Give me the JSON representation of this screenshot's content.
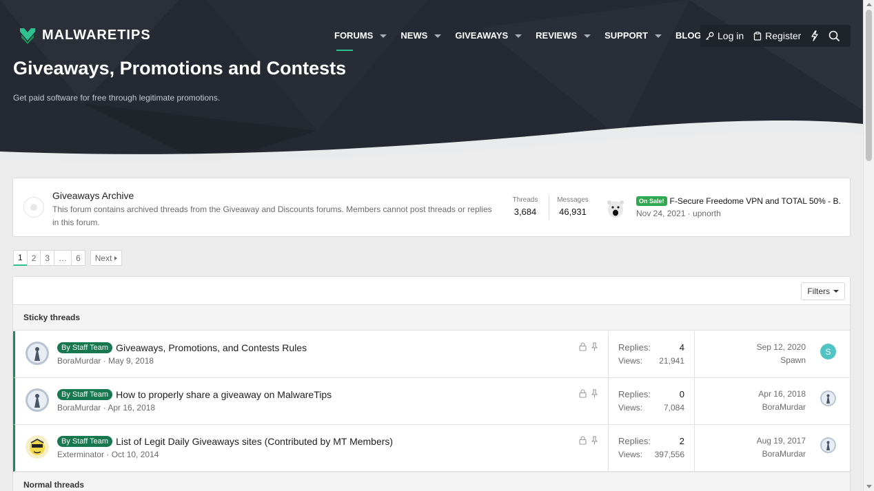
{
  "brand": {
    "name": "MALWARETIPS",
    "accent": "#2ec08e"
  },
  "nav": {
    "items": [
      {
        "label": "FORUMS",
        "active": true,
        "dropdown": true
      },
      {
        "label": "NEWS",
        "dropdown": true
      },
      {
        "label": "GIVEAWAYS",
        "dropdown": true
      },
      {
        "label": "REVIEWS",
        "dropdown": true
      },
      {
        "label": "SUPPORT",
        "dropdown": true
      },
      {
        "label": "BLOG",
        "dropdown": false
      }
    ],
    "login": "Log in",
    "register": "Register"
  },
  "page": {
    "title": "Giveaways, Promotions and Contests",
    "description": "Get paid software for free through legitimate promotions."
  },
  "archive": {
    "title": "Giveaways Archive",
    "description": "This forum contains archived threads from the Giveaway and Discounts forums. Members cannot post threads or replies in this forum.",
    "threads_label": "Threads",
    "threads": "3,684",
    "messages_label": "Messages",
    "messages": "46,931",
    "last_badge": "On Sale!",
    "last_title": "F-Secure Freedome VPN and TOTAL 50% - B...",
    "last_meta": "Nov 24, 2021 · upnorth"
  },
  "pagination": {
    "pages": [
      "1",
      "2",
      "3",
      "…",
      "6"
    ],
    "current": "1",
    "next": "Next"
  },
  "threads": {
    "filters": "Filters",
    "sticky_label": "Sticky threads",
    "normal_label": "Normal threads",
    "replies_label": "Replies:",
    "views_label": "Views:",
    "staff_badge": "By Staff Team",
    "rows": [
      {
        "title": "Giveaways, Promotions, and Contests Rules",
        "author": "BoraMurdar",
        "date": "May 9, 2018",
        "replies": "4",
        "views": "21,941",
        "last_date": "Sep 12, 2020",
        "last_user": "Spawn",
        "last_initial": "S"
      },
      {
        "title": "How to properly share a giveaway on MalwareTips",
        "author": "BoraMurdar",
        "date": "Apr 16, 2018",
        "replies": "0",
        "views": "7,084",
        "last_date": "Apr 16, 2018",
        "last_user": "BoraMurdar"
      },
      {
        "title": "List of Legit Daily Giveaways sites (Contributed by MT Members)",
        "author": "Exterminator",
        "date": "Oct 10, 2014",
        "replies": "2",
        "views": "397,556",
        "last_date": "Aug 19, 2017",
        "last_user": "BoraMurdar"
      }
    ]
  }
}
